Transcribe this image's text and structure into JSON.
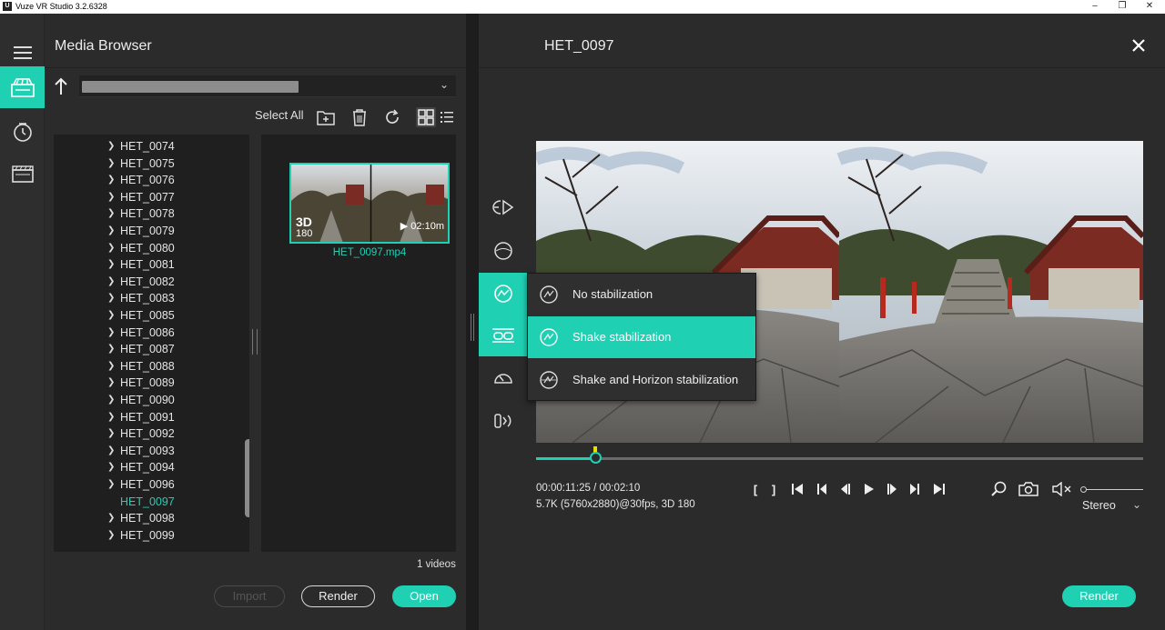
{
  "window": {
    "title": "Vuze VR Studio 3.2.6328",
    "app_icon": "U"
  },
  "colors": {
    "accent": "#1fd0b3",
    "panel": "#2b2b2b",
    "dark": "#1f1f1f"
  },
  "media_browser": {
    "title": "Media Browser",
    "toolbar": {
      "select_all": "Select All"
    },
    "tree": [
      "HET_0074",
      "HET_0075",
      "HET_0076",
      "HET_0077",
      "HET_0078",
      "HET_0079",
      "HET_0080",
      "HET_0081",
      "HET_0082",
      "HET_0083",
      "HET_0085",
      "HET_0086",
      "HET_0087",
      "HET_0088",
      "HET_0089",
      "HET_0090",
      "HET_0091",
      "HET_0092",
      "HET_0093",
      "HET_0094",
      "HET_0096",
      "HET_0097",
      "HET_0098",
      "HET_0099"
    ],
    "selected_item": "HET_0097",
    "thumbnail": {
      "badge": "3D",
      "badge_sub": "180",
      "duration": "▶ 02:10m",
      "name": "HET_0097.mp4"
    },
    "video_count": "1 videos",
    "buttons": {
      "import": "Import",
      "render": "Render",
      "open": "Open"
    }
  },
  "preview": {
    "title": "HET_0097",
    "stabilization_menu": [
      {
        "label": "No stabilization"
      },
      {
        "label": "Shake stabilization",
        "active": true
      },
      {
        "label": "Shake and Horizon stabilization"
      }
    ],
    "playback": {
      "progress": 0.097,
      "marker": 0.1
    },
    "timecode": "00:00:11:25 / 00:02:10",
    "format": "5.7K (5760x2880)@30fps, 3D 180",
    "bracket_in": "[",
    "bracket_out": "]",
    "view_mode": "Stereo",
    "render": "Render"
  }
}
